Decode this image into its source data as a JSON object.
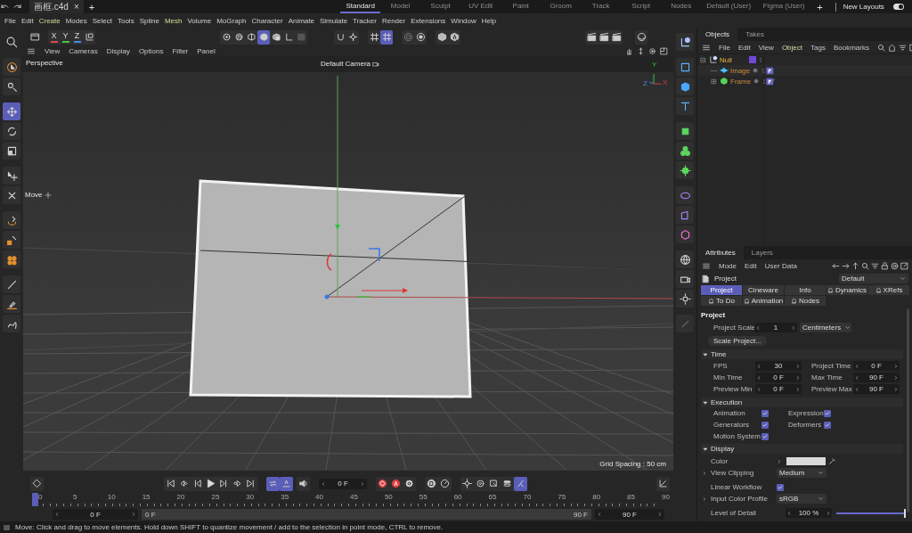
{
  "titlebar": {
    "document_tab": {
      "title": "画框.c4d",
      "close": "×"
    },
    "new_tab": "+",
    "layouts": [
      {
        "label": "Standard",
        "selected": true
      },
      {
        "label": "Model",
        "selected": false
      },
      {
        "label": "Sculpt",
        "selected": false
      },
      {
        "label": "UV Edit",
        "selected": false
      },
      {
        "label": "Paint",
        "selected": false
      },
      {
        "label": "Groom",
        "selected": false
      },
      {
        "label": "Track",
        "selected": false
      },
      {
        "label": "Script",
        "selected": false
      },
      {
        "label": "Nodes",
        "selected": false
      },
      {
        "label": "Default (User)",
        "selected": false
      },
      {
        "label": "Figma (User)",
        "selected": false
      }
    ],
    "add_layout": "+",
    "new_layouts": {
      "label": "New Layouts",
      "on": true
    }
  },
  "menubar": [
    {
      "label": "File",
      "highlighted": false
    },
    {
      "label": "Edit",
      "highlighted": false
    },
    {
      "label": "Create",
      "highlighted": true
    },
    {
      "label": "Modes",
      "highlighted": false
    },
    {
      "label": "Select",
      "highlighted": false
    },
    {
      "label": "Tools",
      "highlighted": false
    },
    {
      "label": "Spline",
      "highlighted": false
    },
    {
      "label": "Mesh",
      "highlighted": true
    },
    {
      "label": "Volume",
      "highlighted": false
    },
    {
      "label": "MoGraph",
      "highlighted": false
    },
    {
      "label": "Character",
      "highlighted": false
    },
    {
      "label": "Animate",
      "highlighted": false
    },
    {
      "label": "Simulate",
      "highlighted": false
    },
    {
      "label": "Tracker",
      "highlighted": false
    },
    {
      "label": "Render",
      "highlighted": false
    },
    {
      "label": "Extensions",
      "highlighted": false
    },
    {
      "label": "Window",
      "highlighted": false
    },
    {
      "label": "Help",
      "highlighted": false
    }
  ],
  "toolbar": {
    "axis_locks": [
      {
        "label": "X",
        "color": "#e04848"
      },
      {
        "label": "Y",
        "color": "#48c048"
      },
      {
        "label": "Z",
        "color": "#4a8ae8"
      }
    ],
    "mode_buttons": [
      {
        "selected": false
      },
      {
        "selected": false
      },
      {
        "selected": false
      },
      {
        "selected": true
      },
      {
        "selected": false
      },
      {
        "selected": false
      },
      {
        "selected": false
      }
    ],
    "snap_buttons": [
      {
        "selected": false
      },
      {
        "selected": true
      }
    ]
  },
  "left_tools": [
    {
      "selected": false
    },
    {
      "selected": false
    },
    {
      "selected": true
    },
    {
      "selected": false
    },
    {
      "selected": false
    },
    {
      "selected": false
    },
    {
      "selected": false
    },
    {
      "selected": false
    },
    {
      "selected": false
    },
    {
      "selected": false
    },
    {
      "selected": false
    },
    {
      "selected": false
    },
    {
      "selected": false
    }
  ],
  "viewport": {
    "menu": [
      "View",
      "Cameras",
      "Display",
      "Options",
      "Filter",
      "Panel"
    ],
    "view_name": "Perspective",
    "camera": "Default Camera",
    "tool_label": "Move",
    "axis_labels": [
      "Y",
      "X",
      "Z"
    ],
    "grid_spacing": "Grid Spacing : 50 cm"
  },
  "objects": {
    "tabs": [
      {
        "label": "Objects",
        "selected": true
      },
      {
        "label": "Takes",
        "selected": false
      }
    ],
    "menu": [
      {
        "label": "File",
        "highlighted": false
      },
      {
        "label": "Edit",
        "highlighted": false
      },
      {
        "label": "View",
        "highlighted": false
      },
      {
        "label": "Object",
        "highlighted": true
      },
      {
        "label": "Tags",
        "highlighted": false
      },
      {
        "label": "Bookmarks",
        "highlighted": false
      }
    ],
    "tree": [
      {
        "name": "Null",
        "kind": "null",
        "active": true,
        "expanded": true,
        "children": [
          {
            "name": "Image",
            "kind": "plane",
            "active": false
          },
          {
            "name": "Frame",
            "kind": "generator",
            "active": false,
            "expanded": false
          }
        ]
      }
    ]
  },
  "attributes": {
    "tabs": [
      {
        "label": "Attributes",
        "selected": true
      },
      {
        "label": "Layers",
        "selected": false
      }
    ],
    "menu": [
      "Mode",
      "Edit",
      "User Data"
    ],
    "object_label": "Project",
    "preset": "Default",
    "page_tabs": [
      {
        "label": "Project",
        "kind": "basic",
        "selected": true
      },
      {
        "label": "Cineware",
        "kind": "basic",
        "selected": false
      },
      {
        "label": "Info",
        "kind": "basic",
        "selected": false
      },
      {
        "label": "Dynamics",
        "kind": "module",
        "selected": false
      },
      {
        "label": "XRefs",
        "kind": "module",
        "selected": false
      },
      {
        "label": "To Do",
        "kind": "module",
        "selected": false
      },
      {
        "label": "Animation",
        "kind": "module",
        "selected": false
      },
      {
        "label": "Nodes",
        "kind": "module",
        "selected": false
      }
    ],
    "project": {
      "title": "Project",
      "scale_label": "Project Scale",
      "scale_value": "1",
      "scale_unit": "Centimeters",
      "scale_button": "Scale Project..."
    },
    "sections": [
      {
        "title": "Time",
        "kind": "fields",
        "expanded": true,
        "items": [
          {
            "label": "FPS",
            "value": "30"
          },
          {
            "label": "Project Time",
            "value": "0 F"
          },
          {
            "label": "Min Time",
            "value": "0 F"
          },
          {
            "label": "Max Time",
            "value": "90 F"
          },
          {
            "label": "Preview Min",
            "value": "0 F"
          },
          {
            "label": "Preview Max",
            "value": "90 F"
          }
        ]
      },
      {
        "title": "Execution",
        "kind": "checks",
        "expanded": true,
        "items": [
          {
            "label": "Animation",
            "checked": true
          },
          {
            "label": "Expression",
            "checked": true
          },
          {
            "label": "Generators",
            "checked": true
          },
          {
            "label": "Deformers",
            "checked": true
          },
          {
            "label": "Motion System",
            "checked": true
          }
        ]
      },
      {
        "title": "Display",
        "kind": "rows",
        "expanded": true,
        "items": [
          {
            "kind": "color",
            "label": "Color",
            "color": "#d9d9d9"
          },
          {
            "kind": "select",
            "label": "View Clipping",
            "value": "Medium"
          },
          {
            "kind": "check",
            "label": "Linear Workflow",
            "checked": true
          },
          {
            "kind": "select",
            "label": "Input Color Profile",
            "value": "sRGB"
          },
          {
            "kind": "slider",
            "label": "Level of Detail",
            "value": "100 %",
            "level": 1
          }
        ]
      }
    ]
  },
  "timeline": {
    "current_frame": "0 F",
    "play_modes": [
      {
        "selected": true
      },
      {
        "selected": true
      }
    ],
    "key_tools": [
      {
        "selected": false
      },
      {
        "selected": false
      },
      {
        "selected": false
      },
      {
        "selected": false
      },
      {
        "selected": true
      }
    ],
    "ruler": {
      "labels": [
        "0",
        "5",
        "10",
        "15",
        "20",
        "25",
        "30",
        "35",
        "40",
        "45",
        "50",
        "55",
        "60",
        "65",
        "70",
        "75",
        "80",
        "85",
        "90"
      ],
      "level": 0
    },
    "range": {
      "start": "0 F",
      "bar_start": "0 F",
      "bar_end": "90 F",
      "end": "90 F"
    }
  },
  "status_bar": {
    "text": "Move: Click and drag to move elements. Hold down SHIFT to quantize movement / add to the selection in point mode, CTRL to remove."
  }
}
